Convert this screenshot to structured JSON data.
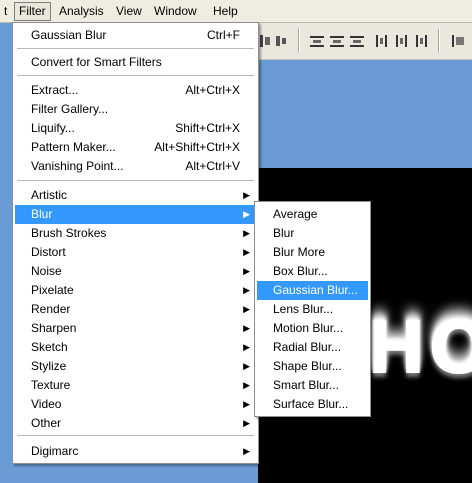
{
  "menubar": {
    "partial": "t",
    "filter": "Filter",
    "analysis": "Analysis",
    "view": "View",
    "window": "Window",
    "help": "Help"
  },
  "canvas_text": "HOL",
  "filter_menu": {
    "gaussian_blur": {
      "label": "Gaussian Blur",
      "shortcut": "Ctrl+F"
    },
    "convert_smart": {
      "label": "Convert for Smart Filters"
    },
    "extract": {
      "label": "Extract...",
      "shortcut": "Alt+Ctrl+X"
    },
    "filter_gallery": {
      "label": "Filter Gallery..."
    },
    "liquify": {
      "label": "Liquify...",
      "shortcut": "Shift+Ctrl+X"
    },
    "pattern_maker": {
      "label": "Pattern Maker...",
      "shortcut": "Alt+Shift+Ctrl+X"
    },
    "vanishing_point": {
      "label": "Vanishing Point...",
      "shortcut": "Alt+Ctrl+V"
    },
    "categories": [
      "Artistic",
      "Blur",
      "Brush Strokes",
      "Distort",
      "Noise",
      "Pixelate",
      "Render",
      "Sharpen",
      "Sketch",
      "Stylize",
      "Texture",
      "Video",
      "Other"
    ],
    "digimarc": "Digimarc",
    "submenu_arrow": "▶"
  },
  "blur_submenu": [
    "Average",
    "Blur",
    "Blur More",
    "Box Blur...",
    "Gaussian Blur...",
    "Lens Blur...",
    "Motion Blur...",
    "Radial Blur...",
    "Shape Blur...",
    "Smart Blur...",
    "Surface Blur..."
  ],
  "colors": {
    "highlight": "#3399ff",
    "menubar": "#efede2",
    "desktop": "#6b9bd4"
  }
}
